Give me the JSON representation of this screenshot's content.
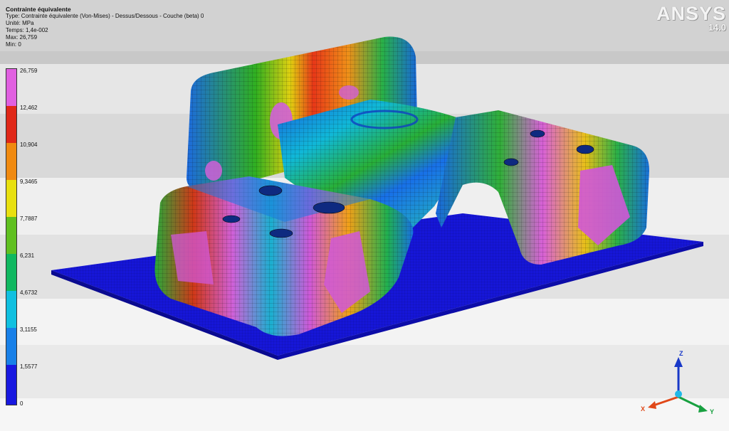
{
  "hud": {
    "title": "Contrainte équivalente",
    "type": "Type: Contrainte équivalente (Von-Mises) - Dessus/Dessous - Couche (beta) 0",
    "unit": "Unité: MPa",
    "time": "Temps: 1,4e-002",
    "max": "Max: 26,759",
    "min": "Min: 0"
  },
  "legend": {
    "labels": [
      "26,759",
      "12,462",
      "10,904",
      "9,3465",
      "7,7887",
      "6,231",
      "4,6732",
      "3,1155",
      "1,5577",
      "0"
    ],
    "colors": [
      "#e060e0",
      "#e02818",
      "#f08a10",
      "#e8e010",
      "#60c020",
      "#10b860",
      "#10c0e0",
      "#1880e8",
      "#1818e0"
    ]
  },
  "logo": {
    "brand": "ANSYS",
    "version": "14.0"
  },
  "triad": {
    "z_label": "Z",
    "x_label": "X",
    "y_label": "Y",
    "z_color": "#1838c8",
    "x_color": "#e04818",
    "y_color": "#18a040"
  }
}
